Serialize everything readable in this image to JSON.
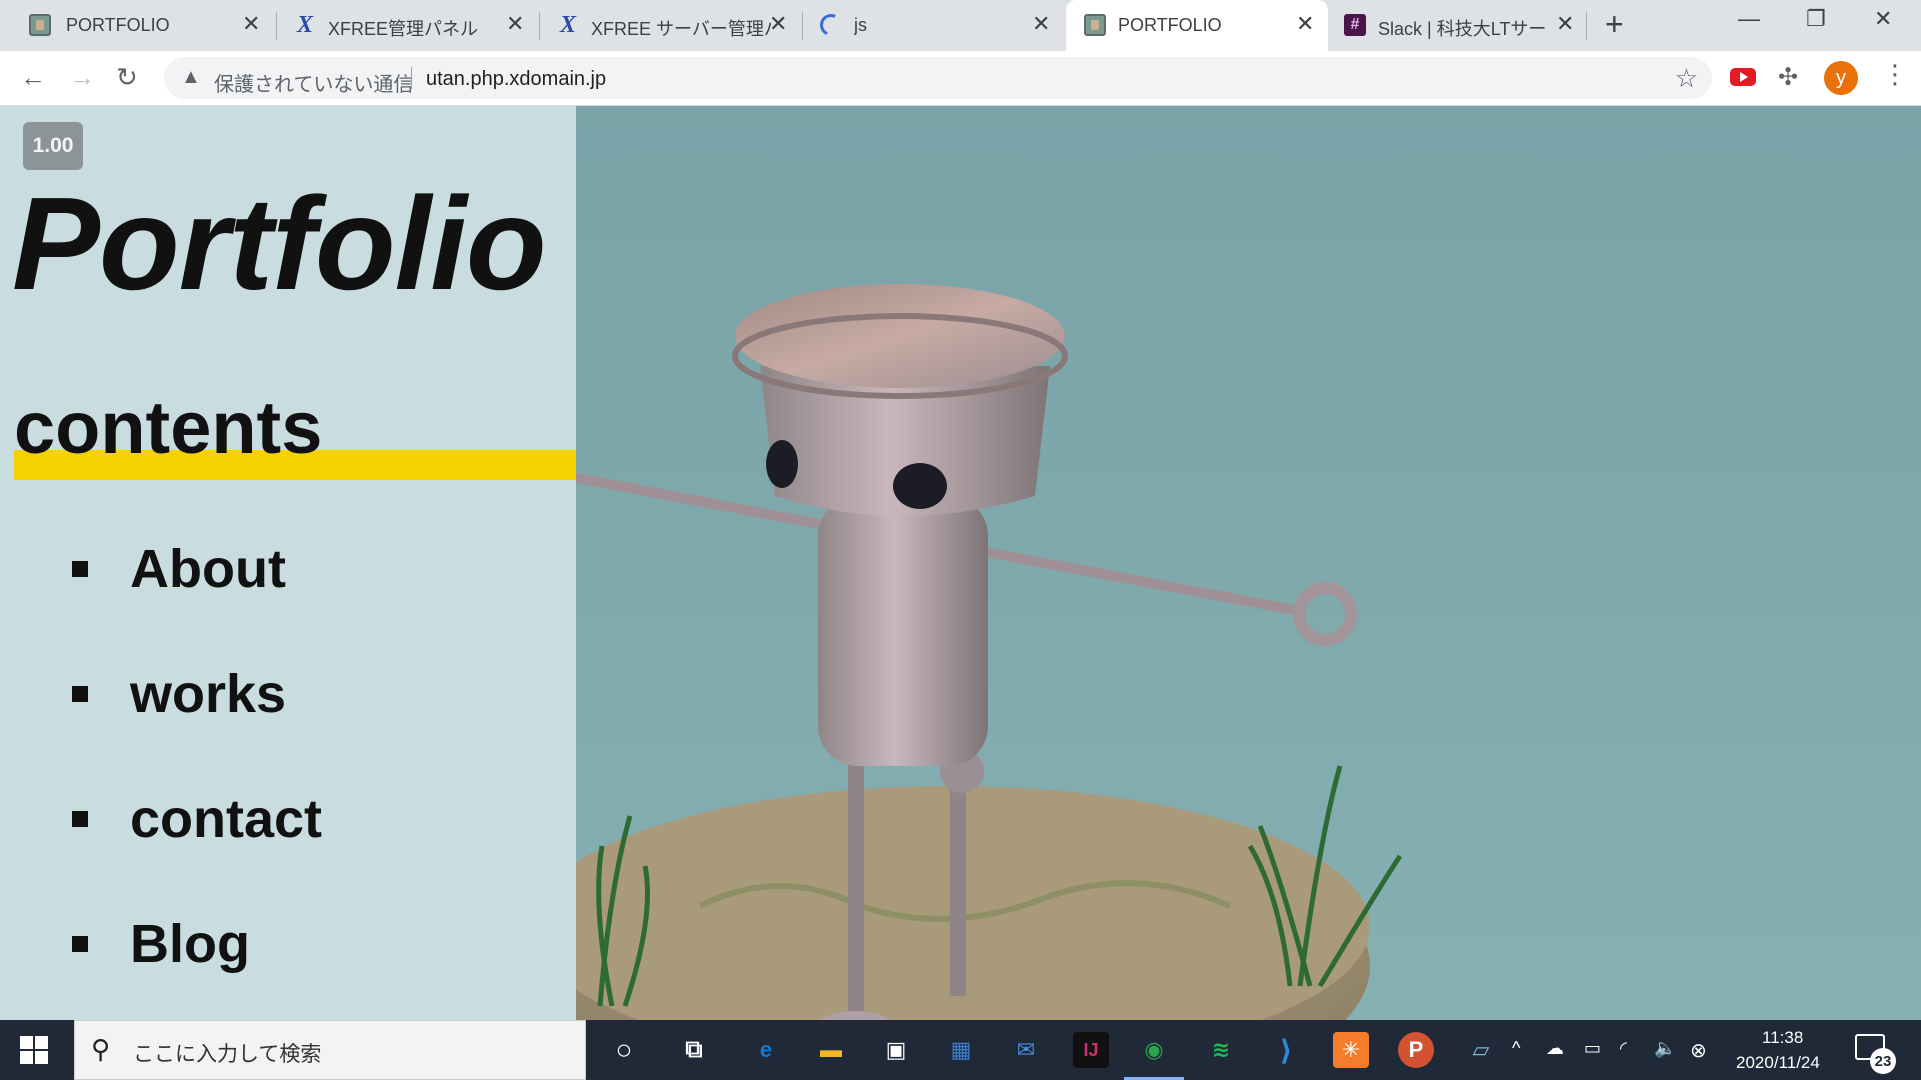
{
  "browser": {
    "tabs": [
      {
        "title": "PORTFOLIO",
        "icon": "portfolio-favicon",
        "active": false
      },
      {
        "title": "XFREE管理パネル",
        "icon": "xfree-favicon",
        "active": false
      },
      {
        "title": "XFREE サーバー管理パネ",
        "icon": "xfree-favicon",
        "active": false
      },
      {
        "title": "js",
        "icon": "moon-favicon",
        "active": false
      },
      {
        "title": "PORTFOLIO",
        "icon": "portfolio-favicon",
        "active": true
      },
      {
        "title": "Slack | 科技大LTサーク",
        "icon": "slack-favicon",
        "active": false
      }
    ],
    "close_glyph": "✕",
    "new_tab_glyph": "+",
    "window_controls": {
      "minimize": "—",
      "restore": "❐",
      "close": "✕"
    },
    "nav": {
      "back": "←",
      "forward": "→",
      "reload": "↻"
    },
    "security_label": "保護されていない通信",
    "url": "utan.php.xdomain.jp",
    "avatar_letter": "y",
    "menu_glyph": "⋮",
    "star_glyph": "☆",
    "puzzle_glyph": "✣",
    "warn_glyph": "▲"
  },
  "page": {
    "badge": "1.00",
    "title": "Portfolio",
    "contents_heading": "contents",
    "nav_items": [
      {
        "label": "About"
      },
      {
        "label": "works"
      },
      {
        "label": "contact"
      },
      {
        "label": "Blog"
      }
    ],
    "colors": {
      "panel_bg": "#c9dcdf",
      "accent_bar": "#f5d200",
      "scene_bg": "#7aa2a7"
    },
    "scene_subject": "3D robot character on grassy dirt platform"
  },
  "taskbar": {
    "search_placeholder": "ここに入力して検索",
    "search_glyph": "⚲",
    "cortana_glyph": "○",
    "taskview_glyph": "⧉",
    "apps": [
      {
        "name": "edge",
        "glyph": "e",
        "color": "#0f7bd6"
      },
      {
        "name": "file-explorer",
        "glyph": "▬",
        "color": "#f2b62b"
      },
      {
        "name": "store",
        "glyph": "▣",
        "color": "#ffffff"
      },
      {
        "name": "remote-desktop",
        "glyph": "▦",
        "color": "#3a7fd0"
      },
      {
        "name": "mail",
        "glyph": "✉",
        "color": "#4a8fe0"
      },
      {
        "name": "intellij",
        "glyph": "IJ",
        "color": "#d12f6d"
      },
      {
        "name": "chrome",
        "glyph": "◉",
        "color": "#2ea44f"
      },
      {
        "name": "spotify",
        "glyph": "≋",
        "color": "#1db954"
      },
      {
        "name": "vscode",
        "glyph": "⟩",
        "color": "#2d8ad9"
      },
      {
        "name": "xampp",
        "glyph": "✳",
        "color": "#f57c2a"
      },
      {
        "name": "powerpoint",
        "glyph": "P",
        "color": "#d35230"
      },
      {
        "name": "notepad",
        "glyph": "▱",
        "color": "#7ab8d9"
      }
    ],
    "tray": {
      "chevron": "^",
      "onedrive": "☁",
      "battery": "▭",
      "wifi": "◜",
      "volume": "🔈",
      "blocked": "⊗"
    },
    "time": "11:38",
    "date": "2020/11/24",
    "notification_count": "23"
  }
}
